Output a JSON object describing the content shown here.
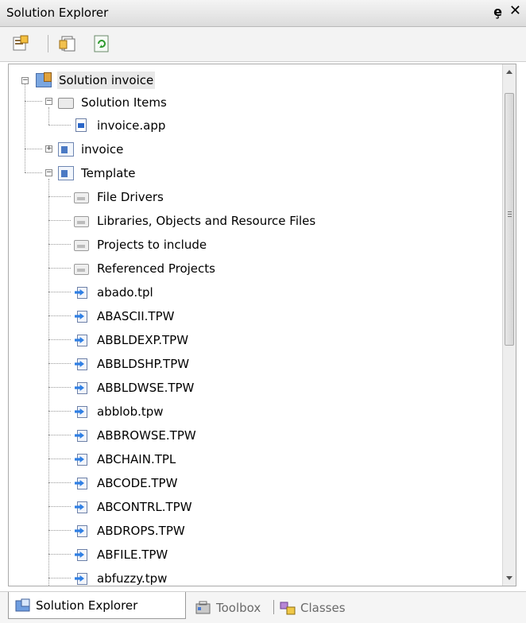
{
  "window": {
    "title": "Solution Explorer",
    "pin_glyph": "ȩ",
    "close_glyph": "✕"
  },
  "toolbar": {
    "buttons": [
      {
        "name": "properties",
        "icon": "properties-icon"
      },
      {
        "name": "show-all-files",
        "icon": "show-all-files-icon"
      },
      {
        "name": "refresh",
        "icon": "refresh-icon"
      }
    ]
  },
  "tree": {
    "root": {
      "label": "Solution invoice",
      "icon": "solution-icon",
      "expanded": true
    },
    "items": [
      {
        "label": "Solution Items",
        "icon": "open-folder-icon",
        "level": 1,
        "expander": "minus"
      },
      {
        "label": "invoice.app",
        "icon": "app-file-icon",
        "level": 2,
        "expander": ""
      },
      {
        "label": "invoice",
        "icon": "project-icon",
        "level": 1,
        "expander": "plus"
      },
      {
        "label": "Template",
        "icon": "project-icon",
        "level": 1,
        "expander": "minus"
      },
      {
        "label": "File Drivers",
        "icon": "folder-icon",
        "level": 2,
        "expander": ""
      },
      {
        "label": "Libraries, Objects and Resource Files",
        "icon": "folder-icon",
        "level": 2,
        "expander": ""
      },
      {
        "label": "Projects to include",
        "icon": "folder-icon",
        "level": 2,
        "expander": ""
      },
      {
        "label": "Referenced Projects",
        "icon": "folder-icon",
        "level": 2,
        "expander": ""
      },
      {
        "label": "abado.tpl",
        "icon": "template-file-icon",
        "level": 2,
        "expander": ""
      },
      {
        "label": "ABASCII.TPW",
        "icon": "template-file-icon",
        "level": 2,
        "expander": ""
      },
      {
        "label": "ABBLDEXP.TPW",
        "icon": "template-file-icon",
        "level": 2,
        "expander": ""
      },
      {
        "label": "ABBLDSHP.TPW",
        "icon": "template-file-icon",
        "level": 2,
        "expander": ""
      },
      {
        "label": "ABBLDWSE.TPW",
        "icon": "template-file-icon",
        "level": 2,
        "expander": ""
      },
      {
        "label": "abblob.tpw",
        "icon": "template-file-icon",
        "level": 2,
        "expander": ""
      },
      {
        "label": "ABBROWSE.TPW",
        "icon": "template-file-icon",
        "level": 2,
        "expander": ""
      },
      {
        "label": "ABCHAIN.TPL",
        "icon": "template-file-icon",
        "level": 2,
        "expander": ""
      },
      {
        "label": "ABCODE.TPW",
        "icon": "template-file-icon",
        "level": 2,
        "expander": ""
      },
      {
        "label": "ABCONTRL.TPW",
        "icon": "template-file-icon",
        "level": 2,
        "expander": ""
      },
      {
        "label": "ABDROPS.TPW",
        "icon": "template-file-icon",
        "level": 2,
        "expander": ""
      },
      {
        "label": "ABFILE.TPW",
        "icon": "template-file-icon",
        "level": 2,
        "expander": ""
      },
      {
        "label": "abfuzzy.tpw",
        "icon": "template-file-icon",
        "level": 2,
        "expander": ""
      }
    ]
  },
  "tabs": [
    {
      "label": "Solution Explorer",
      "icon": "solution-explorer-icon",
      "active": true
    },
    {
      "label": "Toolbox",
      "icon": "toolbox-icon",
      "active": false
    },
    {
      "label": "Classes",
      "icon": "classes-icon",
      "active": false
    }
  ]
}
